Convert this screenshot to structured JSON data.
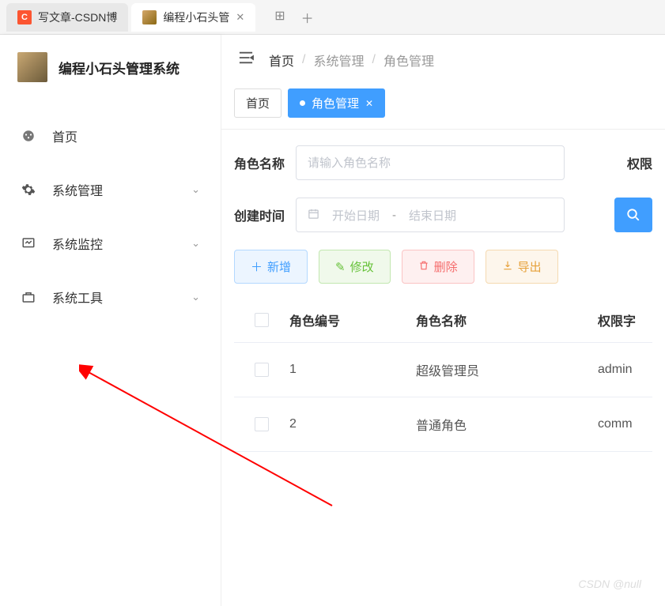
{
  "browser_tabs": {
    "tab1": "写文章-CSDN博",
    "tab2": "编程小石头管"
  },
  "sidebar": {
    "title": "编程小石头管理系统",
    "items": [
      {
        "label": "首页"
      },
      {
        "label": "系统管理"
      },
      {
        "label": "系统监控"
      },
      {
        "label": "系统工具"
      }
    ]
  },
  "breadcrumb": {
    "home": "首页",
    "parent": "系统管理",
    "current": "角色管理"
  },
  "page_tabs": {
    "home": "首页",
    "active": "角色管理"
  },
  "filters": {
    "role_name_label": "角色名称",
    "role_name_placeholder": "请输入角色名称",
    "perm_label": "权限",
    "create_time_label": "创建时间",
    "start_date": "开始日期",
    "end_date": "结束日期"
  },
  "actions": {
    "add": "新增",
    "edit": "修改",
    "delete": "删除",
    "export": "导出"
  },
  "table": {
    "headers": {
      "role_id": "角色编号",
      "role_name": "角色名称",
      "perm": "权限字"
    },
    "rows": [
      {
        "id": "1",
        "name": "超级管理员",
        "perm": "admin"
      },
      {
        "id": "2",
        "name": "普通角色",
        "perm": "comm"
      }
    ]
  },
  "watermark": "CSDN @null"
}
